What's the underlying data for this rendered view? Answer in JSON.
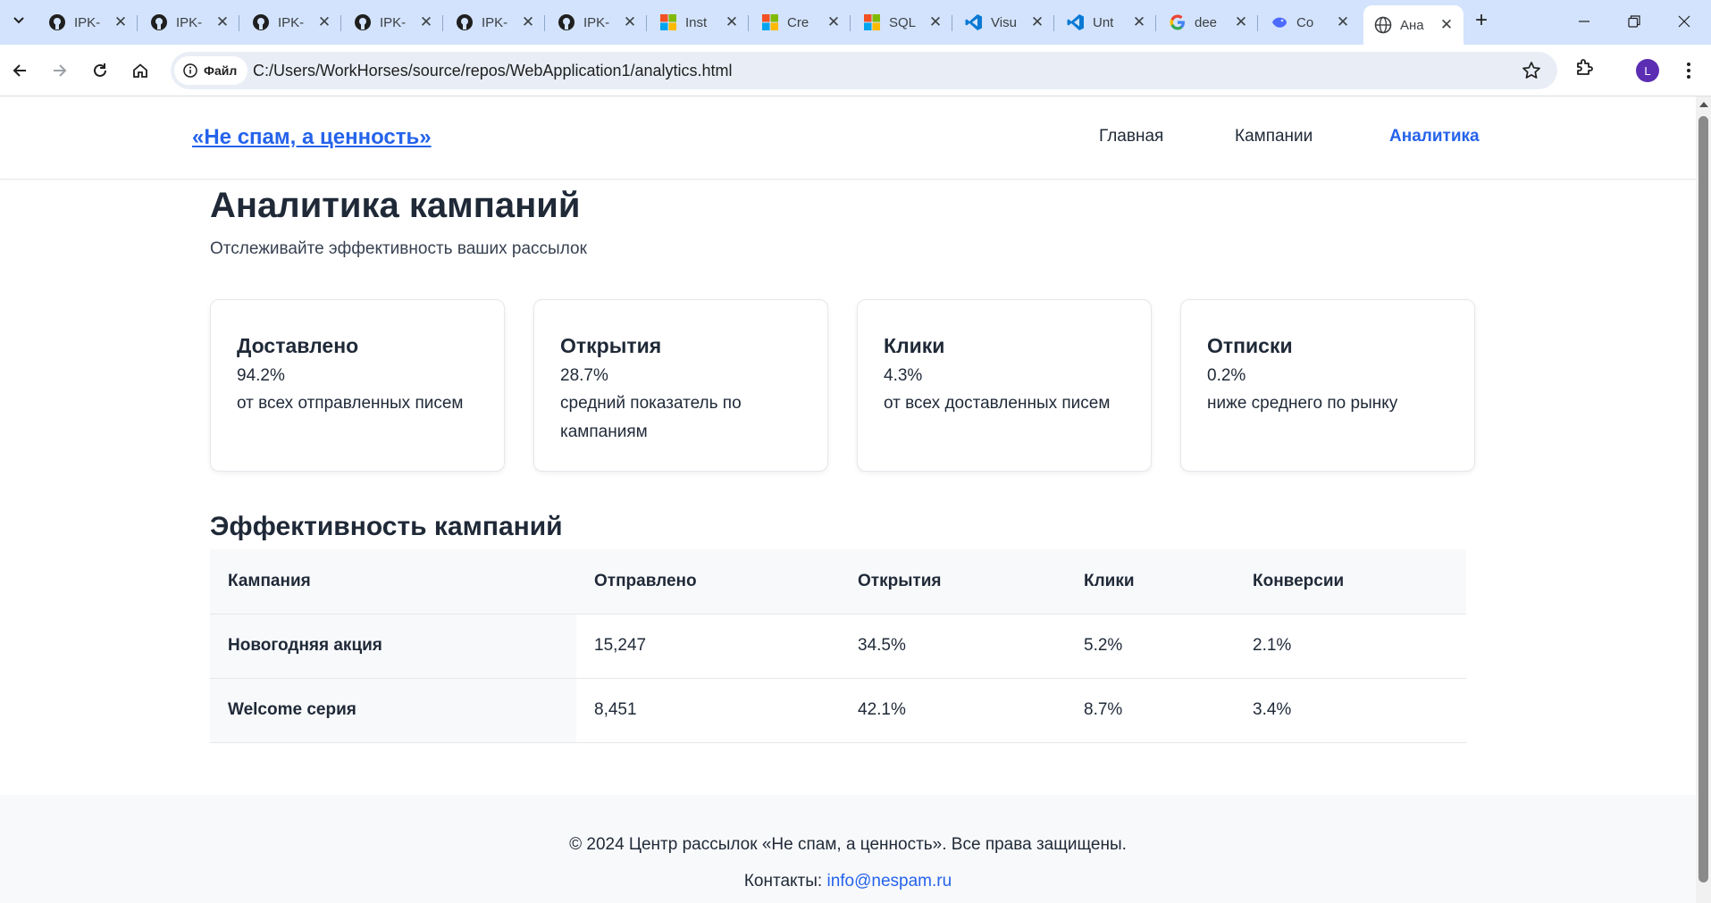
{
  "browser": {
    "tabs": [
      {
        "title": "IPK-",
        "icon": "github-icon"
      },
      {
        "title": "IPK-",
        "icon": "github-icon"
      },
      {
        "title": "IPK-",
        "icon": "github-icon"
      },
      {
        "title": "IPK-",
        "icon": "github-icon"
      },
      {
        "title": "IPK-",
        "icon": "github-icon"
      },
      {
        "title": "IPK-",
        "icon": "github-icon"
      },
      {
        "title": "Inst",
        "icon": "microsoft-icon"
      },
      {
        "title": "Cre",
        "icon": "microsoft-icon"
      },
      {
        "title": "SQL",
        "icon": "microsoft-icon"
      },
      {
        "title": "Visu",
        "icon": "vscode-icon"
      },
      {
        "title": "Unt",
        "icon": "vscode-icon"
      },
      {
        "title": "dee",
        "icon": "google-icon"
      },
      {
        "title": "Co",
        "icon": "deepseek-icon"
      },
      {
        "title": "Ана",
        "icon": "globe-icon",
        "active": true
      }
    ],
    "security_chip": "Файл",
    "url": "C:/Users/WorkHorses/source/repos/WebApplication1/analytics.html",
    "profile_initial": "L"
  },
  "site": {
    "logo": "«Не спам, а ценность»",
    "nav": {
      "home": "Главная",
      "campaigns": "Кампании",
      "analytics": "Аналитика"
    },
    "accent_color": "#2563eb"
  },
  "page": {
    "title": "Аналитика кампаний",
    "subtitle": "Отслеживайте эффективность ваших рассылок"
  },
  "stats": [
    {
      "label": "Доставлено",
      "value": "94.2%",
      "desc": "от всех отправленных писем"
    },
    {
      "label": "Открытия",
      "value": "28.7%",
      "desc": "средний показатель по кампаниям"
    },
    {
      "label": "Клики",
      "value": "4.3%",
      "desc": "от всех доставленных писем"
    },
    {
      "label": "Отписки",
      "value": "0.2%",
      "desc": "ниже среднего по рынку"
    }
  ],
  "performance": {
    "title": "Эффективность кампаний",
    "columns": [
      "Кампания",
      "Отправлено",
      "Открытия",
      "Клики",
      "Конверсии"
    ],
    "rows": [
      [
        "Новогодняя акция",
        "15,247",
        "34.5%",
        "5.2%",
        "2.1%"
      ],
      [
        "Welcome серия",
        "8,451",
        "42.1%",
        "8.7%",
        "3.4%"
      ]
    ]
  },
  "footer": {
    "copyright": "© 2024 Центр рассылок «Не спам, а ценность». Все права защищены.",
    "contacts_label": "Контакты:",
    "email": "info@nespam.ru"
  }
}
